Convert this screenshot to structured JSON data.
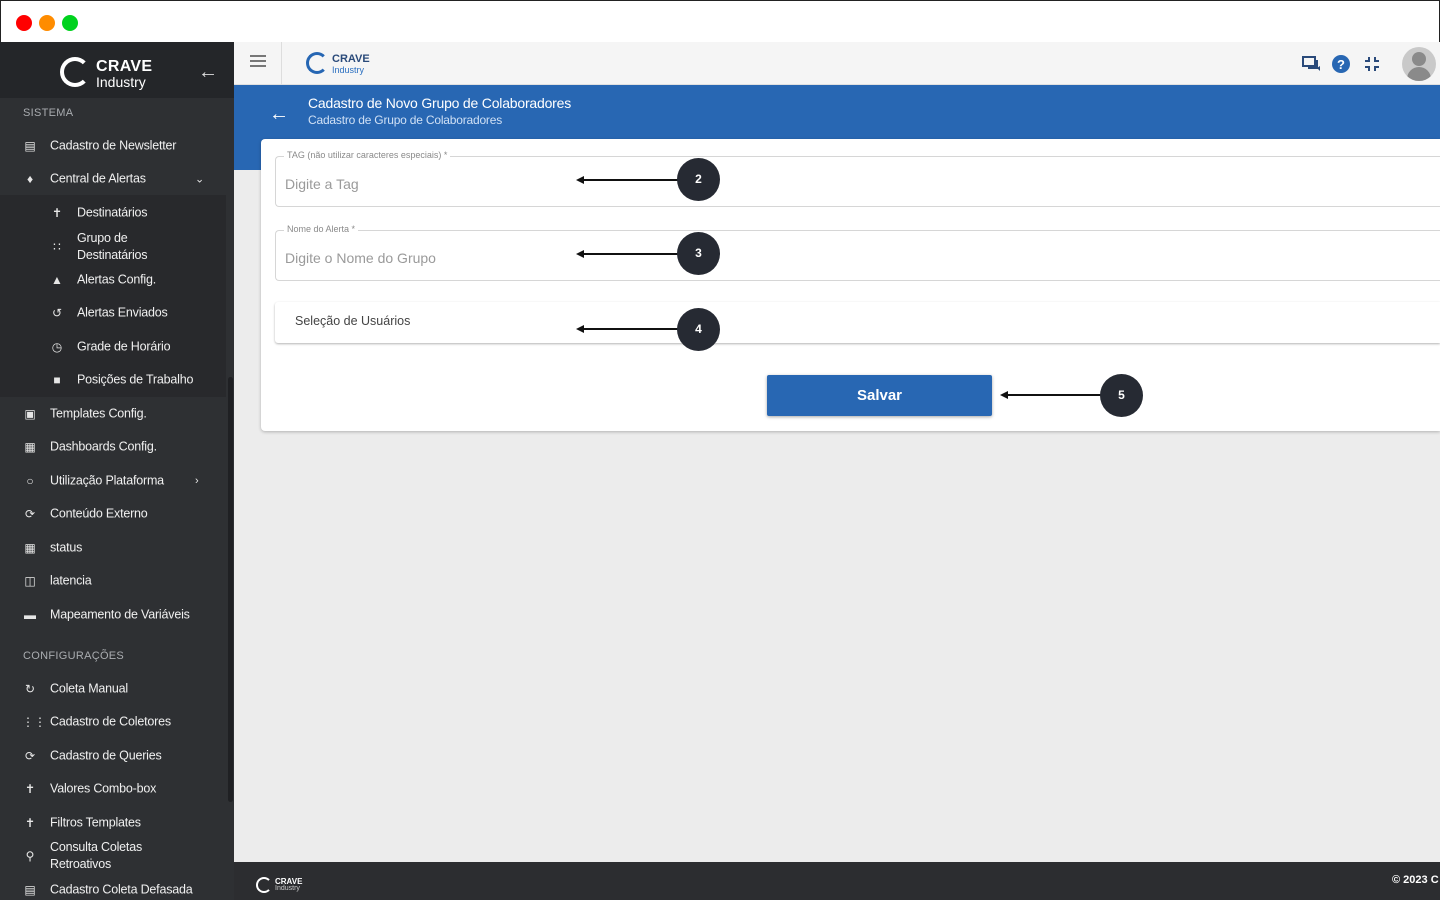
{
  "brand": {
    "name": "CRAVE",
    "tagline": "Industry"
  },
  "sidebar": {
    "section_system": "SISTEMA",
    "section_config": "CONFIGURAÇÕES",
    "items": [
      {
        "label": "Cadastro de Newsletter",
        "icon": "newsletter-icon"
      },
      {
        "label": "Central de Alertas",
        "icon": "bell-icon"
      },
      {
        "label": "Destinatários",
        "icon": "person-icon"
      },
      {
        "label": "Grupo de Destinatários",
        "icon": "group-icon"
      },
      {
        "label": "Alertas Config.",
        "icon": "alert-config-icon"
      },
      {
        "label": "Alertas Enviados",
        "icon": "history-icon"
      },
      {
        "label": "Grade de Horário",
        "icon": "clock-icon"
      },
      {
        "label": "Posições de Trabalho",
        "icon": "briefcase-icon"
      },
      {
        "label": "Templates Config.",
        "icon": "templates-icon"
      },
      {
        "label": "Dashboards Config.",
        "icon": "dashboard-icon"
      },
      {
        "label": "Utilização Plataforma",
        "icon": "circle-icon"
      },
      {
        "label": "Conteúdo Externo",
        "icon": "external-content-icon"
      },
      {
        "label": "status",
        "icon": "grid-icon"
      },
      {
        "label": "latencia",
        "icon": "timer-icon"
      },
      {
        "label": "Mapeamento de Variáveis",
        "icon": "map-icon"
      },
      {
        "label": "Coleta Manual",
        "icon": "refresh-icon"
      },
      {
        "label": "Cadastro de Coletores",
        "icon": "apps-icon"
      },
      {
        "label": "Cadastro de Queries",
        "icon": "sync-icon"
      },
      {
        "label": "Valores Combo-box",
        "icon": "person-icon"
      },
      {
        "label": "Filtros Templates",
        "icon": "person-icon"
      },
      {
        "label": "Consulta Coletas Retroativos",
        "icon": "search-icon"
      },
      {
        "label": "Cadastro Coleta Defasada",
        "icon": "list-icon"
      }
    ]
  },
  "header": {
    "title": "Cadastro de Novo Grupo de Colaboradores",
    "subtitle": "Cadastro de Grupo de Colaboradores"
  },
  "form": {
    "tag_label": "TAG (não utilizar caracteres especiais) *",
    "tag_placeholder": "Digite a Tag",
    "name_label": "Nome do Alerta *",
    "name_placeholder": "Digite o Nome do Grupo",
    "users_label": "Seleção de Usuários",
    "save_label": "Salvar"
  },
  "annotations": [
    "2",
    "3",
    "4",
    "5"
  ],
  "footer": {
    "copyright": "© 2023 C"
  },
  "colors": {
    "primary": "#2867b3",
    "sidebar": "#2e3033",
    "footer": "#2c2d30"
  }
}
